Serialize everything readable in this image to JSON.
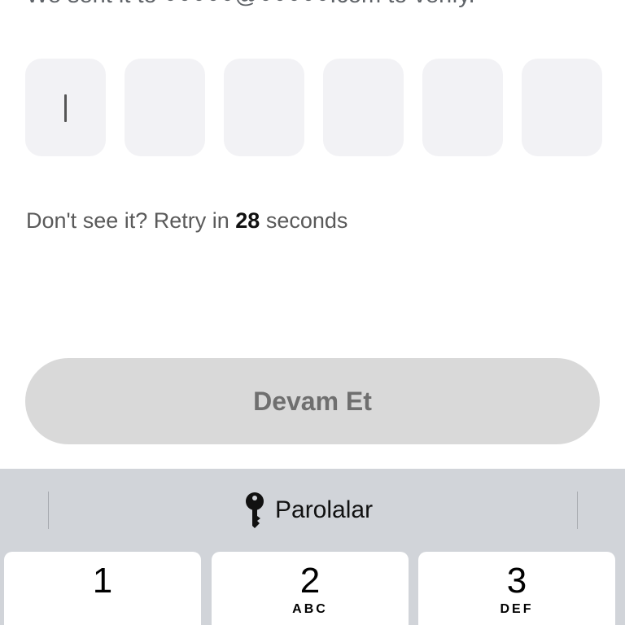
{
  "verify": {
    "subtitle": "We sent it to ●●●●●@●●●●●.com to verify.",
    "code_boxes": [
      "",
      "",
      "",
      "",
      "",
      ""
    ],
    "retry_prefix": "Don't see it? Retry in",
    "retry_count": "28",
    "retry_suffix": "seconds",
    "continue_label": "Devam Et"
  },
  "keyboard": {
    "suggestion_label": "Parolalar",
    "suggestion_icon": "key-icon",
    "keys": [
      {
        "digit": "1",
        "letters": ""
      },
      {
        "digit": "2",
        "letters": "ABC"
      },
      {
        "digit": "3",
        "letters": "DEF"
      }
    ]
  },
  "colors": {
    "code_box_bg": "#f2f2f5",
    "button_disabled_bg": "#d9d9d9",
    "keyboard_bg": "#d1d4d9"
  }
}
